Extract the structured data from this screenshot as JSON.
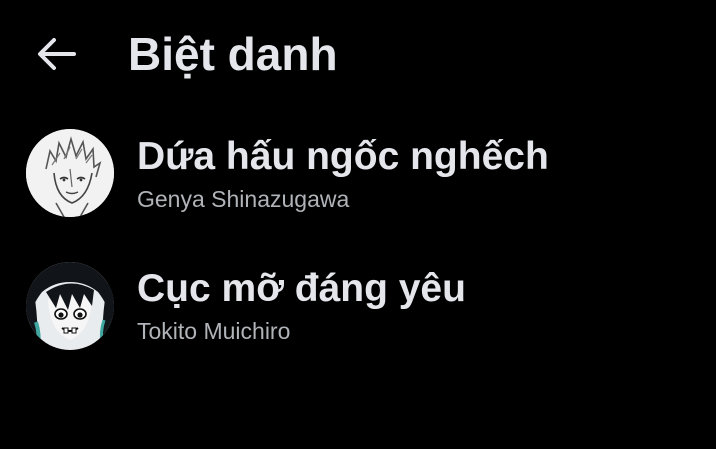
{
  "header": {
    "back_icon": "arrow-left-icon",
    "title": "Biệt danh"
  },
  "nicknames": [
    {
      "nickname": "Dứa hấu ngốc nghếch",
      "name": "Genya Shinazugawa",
      "avatar": "sketch-character-avatar"
    },
    {
      "nickname": "Cục mỡ đáng yêu",
      "name": "Tokito Muichiro",
      "avatar": "dark-hair-character-avatar"
    }
  ],
  "colors": {
    "background": "#000000",
    "primary_text": "#e4e6eb",
    "secondary_text": "#b0b3b8"
  }
}
